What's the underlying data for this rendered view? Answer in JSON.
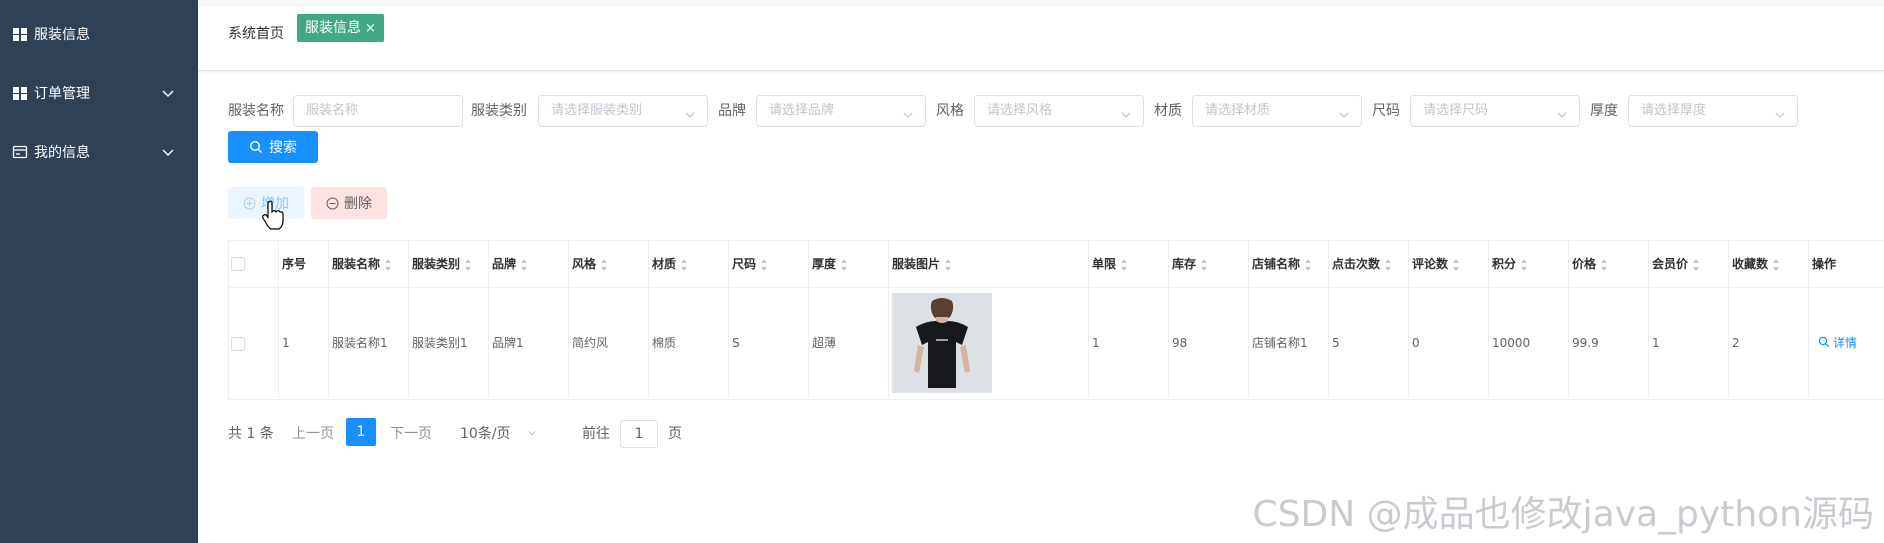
{
  "sidebar": {
    "items": [
      {
        "label": "服装信息",
        "icon": "grid-icon"
      },
      {
        "label": "订单管理",
        "icon": "grid-icon"
      },
      {
        "label": "我的信息",
        "icon": "card-icon"
      }
    ]
  },
  "tabs": {
    "home": "系统首页",
    "active": "服装信息",
    "close": "×"
  },
  "filters": {
    "name_label": "服装名称",
    "name_placeholder": "服装名称",
    "category_label": "服装类别",
    "category_placeholder": "请选择服装类别",
    "brand_label": "品牌",
    "brand_placeholder": "请选择品牌",
    "style_label": "风格",
    "style_placeholder": "请选择风格",
    "material_label": "材质",
    "material_placeholder": "请选择材质",
    "size_label": "尺码",
    "size_placeholder": "请选择尺码",
    "thickness_label": "厚度",
    "thickness_placeholder": "请选择厚度"
  },
  "toolbar": {
    "search": "搜索",
    "add": "增加",
    "delete": "删除"
  },
  "table": {
    "headers": [
      "序号",
      "服装名称",
      "服装类别",
      "品牌",
      "风格",
      "材质",
      "尺码",
      "厚度",
      "服装图片",
      "单限",
      "库存",
      "店铺名称",
      "点击次数",
      "评论数",
      "积分",
      "价格",
      "会员价",
      "收藏数",
      "操作"
    ],
    "rows": [
      {
        "index": "1",
        "name": "服装名称1",
        "category": "服装类别1",
        "brand": "品牌1",
        "style": "简约风",
        "material": "棉质",
        "size": "S",
        "thickness": "超薄",
        "limit": "1",
        "stock": "98",
        "shop": "店铺名称1",
        "clicks": "5",
        "comments": "0",
        "points": "10000",
        "price": "99.9",
        "member_price": "1",
        "favorites": "2",
        "action": "详情"
      }
    ]
  },
  "pagination": {
    "total": "共 1 条",
    "prev": "上一页",
    "current": "1",
    "next": "下一页",
    "page_size": "10条/页",
    "goto": "前往",
    "goto_value": "1",
    "page_unit": "页"
  },
  "watermark": "CSDN @成品也修改java_python源码",
  "colors": {
    "sidebar_bg": "#304156",
    "primary": "#1890ff",
    "tag_active": "#42a884",
    "danger_bg": "#fde2e2"
  }
}
